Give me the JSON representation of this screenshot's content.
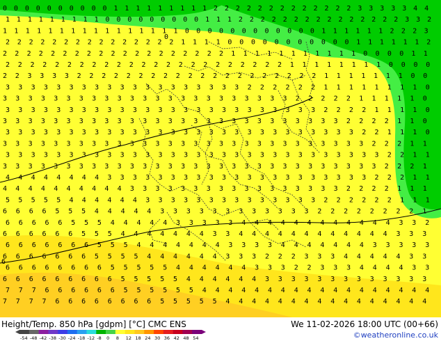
{
  "map": {
    "colors": {
      "yellow": "#ffff33",
      "yellow_orange": "#ffe61c",
      "orange": "#ffcf22",
      "light_green": "#44ee44",
      "green": "#00cc00",
      "border_line": "#3a3a3a",
      "contour_line": "#000000"
    },
    "value_rows": [
      "0 0 0 0 0 0 0 0 0 0 1 1 1 1 1 1 1 1 1 2 2 2 2 2 2 2 2 2 2 2 2 2 3 3 3 3 3 4 4",
      "1 1 1 1 1 1 1 1 1 0 0 0 0 0 0 0 0 0 1 1 1 2 2 2 2 2 2 2 2 2 2 2 2 2 2 2 3 3 2",
      "1 1 1 1 1 1 1 1 1 1 1 1 1 1 1 1 0 0 0 0 0 0 0 0 0 0 0 0 1 1 1 1 1 1 2 2 2 3",
      "2 2 2 2 2 2 2 2 2 2 2 2 2 2 2 1 1 1 1 0 0 0 0 0 0 0 0 0 0 0 1 1 1 1 1 1 2",
      "2 2 2 2 2 2 2 2 2 2 2 2 2 2 2 2 2 2 2 1 1 1 1 1 1 1 1 1 1 1 0 0 0 0 1 1",
      "2 2 2 2 2 2 2 2 2 2 2 2 2 2 2 2 2 2 2 2 2 2 2 1 1 1 1 1 1 1 1 0 0 0 0",
      "2 2 3 3 3 3 2 2 2 2 2 2 2 2 2 2 2 2 2 2 2 2 2 2 2 2 1 1 1 1 1 1 1 0 0",
      "3 3 3 3 3 3 3 3 3 3 3 3 3 3 3 3 3 3 3 2 2 2 2 2 2 1 1 1 1 1 1 1 1 0",
      "3 3 3 3 3 3 3 3 3 3 3 3 3 3 3 3 3 3 3 3 3 3 3 2 2 2 2 2 1 1 1 1 1 0",
      "3 3 3 3 3 3 3 3 3 3 3 3 3 3 3 3 3 3 3 3 3 3 3 3 3 2 2 2 2 1 1 1 1 0",
      "3 3 3 3 3 3 3 3 3 3 3 3 3 3 3 3 3 3 3 3 3 3 3 3 3 3 3 2 2 2 2 1 1 0",
      "3 3 3 3 3 3 3 3 3 3 3 3 3 3 3 3 3 3 3 3 3 3 3 3 3 3 3 3 2 2 1 1 1 0",
      "3 3 3 3 3 3 3 3 3 3 3 3 3 3 3 3 3 3 3 3 3 3 3 3 3 3 3 3 3 2 2 2 1 1",
      "3 3 3 3 3 3 3 3 3 3 3 3 3 3 3 3 3 3 3 3 3 3 3 3 3 3 3 3 3 3 2 2 1 1",
      "3 3 3 3 3 3 3 3 3 3 3 3 3 3 3 3 3 3 3 3 3 3 3 3 3 3 3 3 3 3 2 2 2 1",
      "4 4 4 4 4 4 4 4 3 3 3 3 3 3 3 3 3 3 3 3 3 3 3 3 3 3 3 3 3 2 2 2 1 1",
      "4 4 4 4 4 4 4 4 4 4 3 3 3 3 3 3 3 3 3 3 3 3 3 3 3 3 3 2 2 2 2 1 1 1",
      "5 5 5 5 5 4 4 4 4 4 4 3 3 3 3 3 3 3 3 3 3 3 3 3 3 2 2 2 2 2 2 1 1 1",
      "6 6 6 6 5 5 5 4 4 4 4 4 3 3 3 3 3 3 3 3 3 3 3 3 2 2 2 2 2 2 2 2 1",
      "6 6 6 6 6 5 5 5 4 4 4 4 4 3 3 3 3 3 4 4 4 4 4 4 4 4 4 4 4 4 3 3 2",
      "6 6 6 6 6 6 5 5 5 4 4 4 4 4 4 4 3 3 4 4 4 4 4 4 4 4 4 4 4 4 3 3 3",
      "6 6 6 6 6 6 6 5 5 5 4 4 4 4 4 4 4 3 3 3 3 4 4 4 4 4 4 4 3 3 3 3 3",
      "6 6 6 6 6 6 6 5 5 5 5 4 4 4 4 4 4 3 3 3 2 2 2 3 3 3 4 4 4 4 4 3 3",
      "6 6 6 6 6 6 6 6 5 5 5 5 5 4 4 4 4 4 4 3 3 3 2 2 3 3 3 4 4 4 4 3 3",
      "6 6 6 6 6 6 6 6 6 5 5 5 5 5 4 4 4 4 4 4 3 3 3 3 3 3 3 3 3 3 3 3 3",
      "7 7 7 6 6 6 6 6 6 5 5 5 5 5 5 4 4 4 4 4 4 4 4 4 4 4 4 4 4 4 4 4 4",
      "7 7 7 7 6 6 6 6 6 6 6 6 5 5 5 5 5 4 4 4 4 4 4 4 4 4 4 4 4 4 4 4 4"
    ],
    "contour_labels": [
      "0",
      "6"
    ]
  },
  "footer": {
    "left_label": "Height/Temp. 850 hPa [gdpm] [°C] CMC ENS",
    "right_label": "We 11-02-2026 18:00 UTC (00+66)",
    "credit": "©weatheronline.co.uk",
    "legend": {
      "ticks": [
        "-54",
        "-48",
        "-42",
        "-38",
        "-30",
        "-24",
        "-18",
        "-12",
        "-8",
        "0",
        "8",
        "12",
        "18",
        "24",
        "30",
        "36",
        "42",
        "48",
        "54"
      ],
      "colors": [
        "#444444",
        "#666666",
        "#8c1ea0",
        "#6f38c8",
        "#3c3ce6",
        "#1e6ef0",
        "#2aa0f0",
        "#2adcdc",
        "#00b400",
        "#46d246",
        "#ffff33",
        "#ffe61c",
        "#ffc81e",
        "#ff9600",
        "#ff4600",
        "#e61e1e",
        "#c8001e",
        "#a00050",
        "#7a007a"
      ]
    }
  }
}
